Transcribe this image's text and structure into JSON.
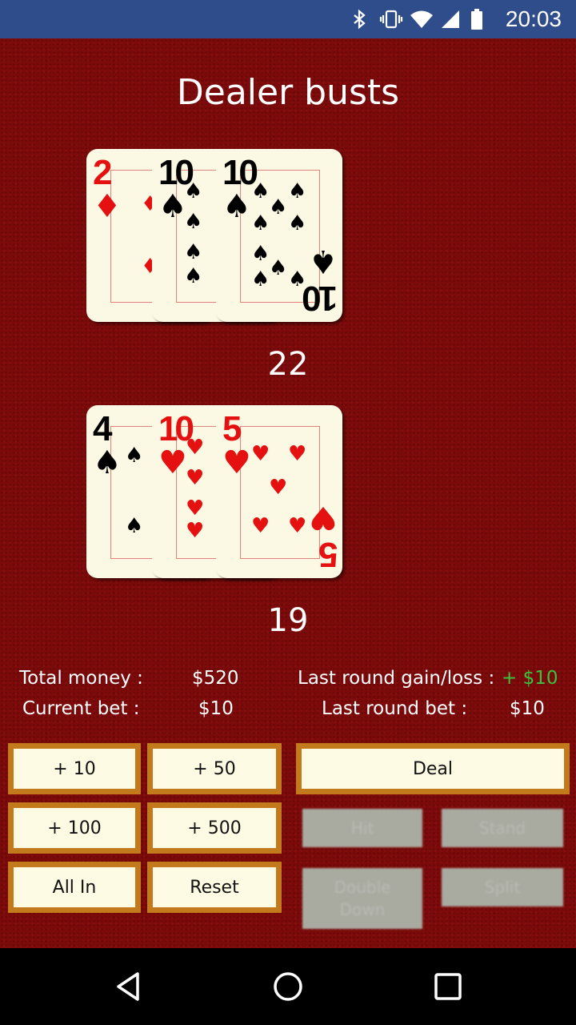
{
  "status_bar": {
    "time": "20:03",
    "icons": [
      "bluetooth-icon",
      "vibrate-icon",
      "wifi-icon",
      "signal-icon",
      "battery-icon"
    ]
  },
  "title": "Dealer busts",
  "dealer": {
    "score": "22",
    "cards": [
      {
        "rank": "2",
        "suit": "♦",
        "color": "red"
      },
      {
        "rank": "10",
        "suit": "♠",
        "color": "black"
      },
      {
        "rank": "10",
        "suit": "♠",
        "color": "black"
      }
    ]
  },
  "player": {
    "score": "19",
    "cards": [
      {
        "rank": "4",
        "suit": "♠",
        "color": "black"
      },
      {
        "rank": "10",
        "suit": "♥",
        "color": "red"
      },
      {
        "rank": "5",
        "suit": "♥",
        "color": "red"
      }
    ]
  },
  "info": {
    "total_money_label": "Total money :",
    "total_money_value": "$520",
    "current_bet_label": "Current bet :",
    "current_bet_value": "$10",
    "last_gain_label": "Last round gain/loss :",
    "last_gain_value": "+ $10",
    "last_bet_label": "Last round bet :",
    "last_bet_value": "$10"
  },
  "buttons": {
    "plus10": "+ 10",
    "plus50": "+ 50",
    "plus100": "+ 100",
    "plus500": "+ 500",
    "all_in": "All In",
    "reset": "Reset",
    "deal": "Deal",
    "hit": "Hit",
    "stand": "Stand",
    "double_down": "Double Down",
    "split": "Split"
  },
  "colors": {
    "felt": "#7d0a0a",
    "button_border": "#c27a1c",
    "button_fill": "#fdfbe3",
    "gain": "#3ec23e",
    "status_bar": "#2f4d8a"
  }
}
